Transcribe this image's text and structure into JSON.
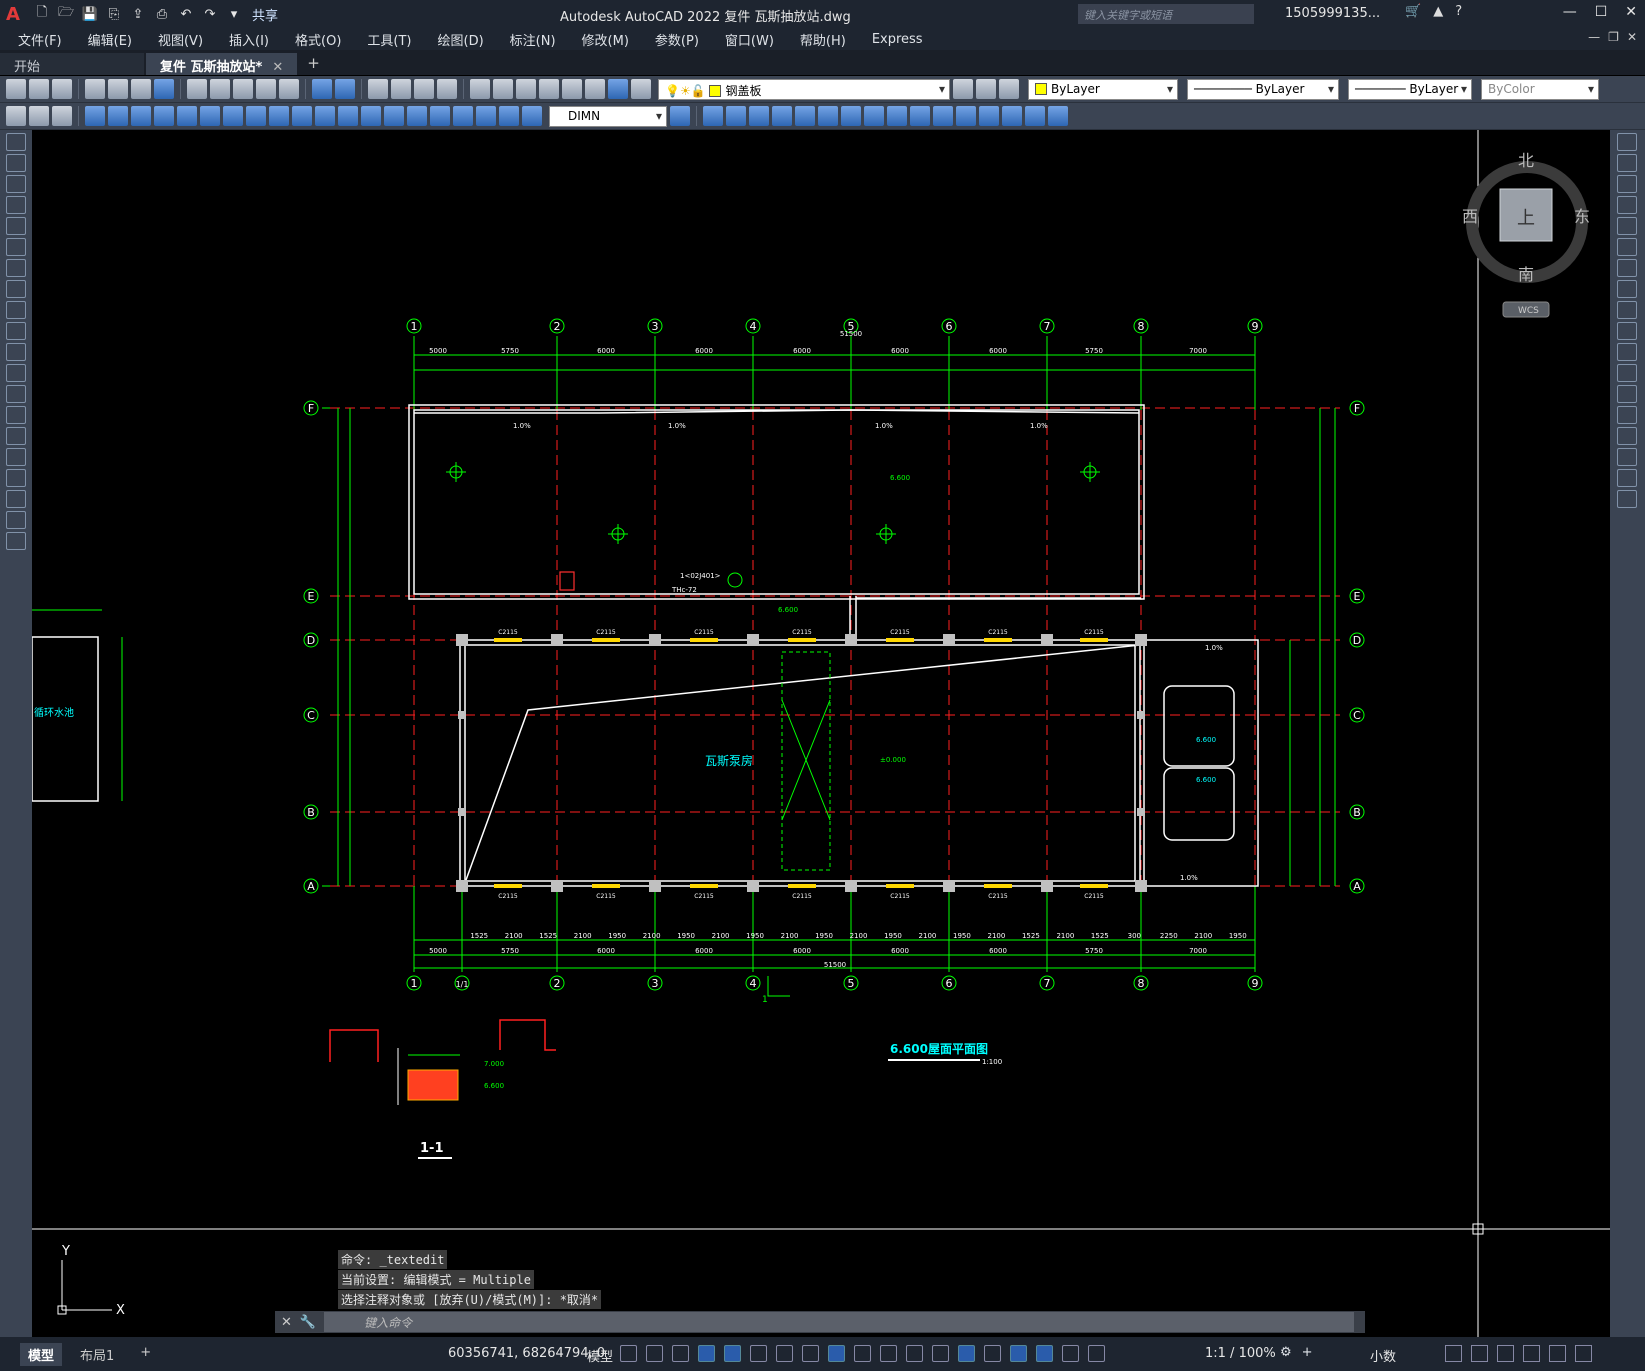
{
  "app": {
    "logo": "A",
    "title": "Autodesk AutoCAD 2022    复件 瓦斯抽放站.dwg",
    "share": "共享",
    "search_placeholder": "键入关键字或短语",
    "user": "1505999135...",
    "window_controls": [
      "—",
      "☐",
      "✕"
    ]
  },
  "menu": [
    "文件(F)",
    "编辑(E)",
    "视图(V)",
    "插入(I)",
    "格式(O)",
    "工具(T)",
    "绘图(D)",
    "标注(N)",
    "修改(M)",
    "参数(P)",
    "窗口(W)",
    "帮助(H)",
    "Express"
  ],
  "doc_tabs": [
    {
      "label": "开始",
      "active": false
    },
    {
      "label": "复件 瓦斯抽放站*",
      "active": true
    }
  ],
  "properties": {
    "layer": "钢盖板",
    "color": "ByLayer",
    "linetype": "ByLayer",
    "lineweight": "ByLayer",
    "plotstyle": "ByColor",
    "dimstyle": "DIMN"
  },
  "viewcube": {
    "north": "北",
    "south": "南",
    "east": "东",
    "west": "西",
    "top": "上",
    "wcs": "WCS"
  },
  "drawing": {
    "grid_cols": [
      "1",
      "2",
      "3",
      "4",
      "5",
      "6",
      "7",
      "8",
      "9"
    ],
    "grid_rows": [
      "F",
      "E",
      "D",
      "C",
      "B",
      "A"
    ],
    "top_dims": [
      "5000",
      "5750",
      "6000",
      "6000",
      "6000",
      "6000",
      "6000",
      "5750",
      "7000"
    ],
    "overall_top": "51500",
    "room_label": "瓦斯泵房",
    "plan_title": "6.600屋面平面图",
    "plan_scale": "1:100",
    "section_label": "1-1",
    "left_label": "循环水池",
    "level_0": "±0.000",
    "level_66": "6.600",
    "level_70": "7.000",
    "window_tag": "C2115",
    "slope": "1.0%",
    "section_mark": "1",
    "column_1a": "1/1",
    "bottom_overall": "51500",
    "bottom_dims": [
      "5000",
      "5750",
      "6000",
      "6000",
      "6000",
      "6000",
      "6000",
      "5750",
      "7000"
    ],
    "bottom_sub": [
      "1525",
      "2100",
      "1525",
      "2100",
      "1950",
      "2100",
      "1950",
      "2100",
      "1950",
      "2100",
      "1950",
      "2100",
      "1950",
      "2100",
      "1950",
      "2100",
      "1525",
      "2100",
      "1525",
      "300",
      "2250",
      "2100",
      "1950"
    ],
    "callout": "1<02J401>",
    "callout2": "THc-72"
  },
  "command": {
    "line1": "命令: _textedit",
    "line2": "当前设置: 编辑模式 = Multiple",
    "line3": "选择注释对象或 [放弃(U)/模式(M)]: *取消*",
    "placeholder": "键入命令"
  },
  "status": {
    "layout_tabs": [
      "模型",
      "布局1"
    ],
    "coords": "60356741, 68264794, 0",
    "space": "模型",
    "scale": "1:1 / 100%",
    "units": "小数"
  },
  "ucs": {
    "x": "X",
    "y": "Y"
  },
  "colors": {
    "grid": "#00ff00",
    "axis_red": "#ff2020",
    "wall": "#ffffff",
    "text_cyan": "#00ffff",
    "accent": "#2e6fd4"
  }
}
